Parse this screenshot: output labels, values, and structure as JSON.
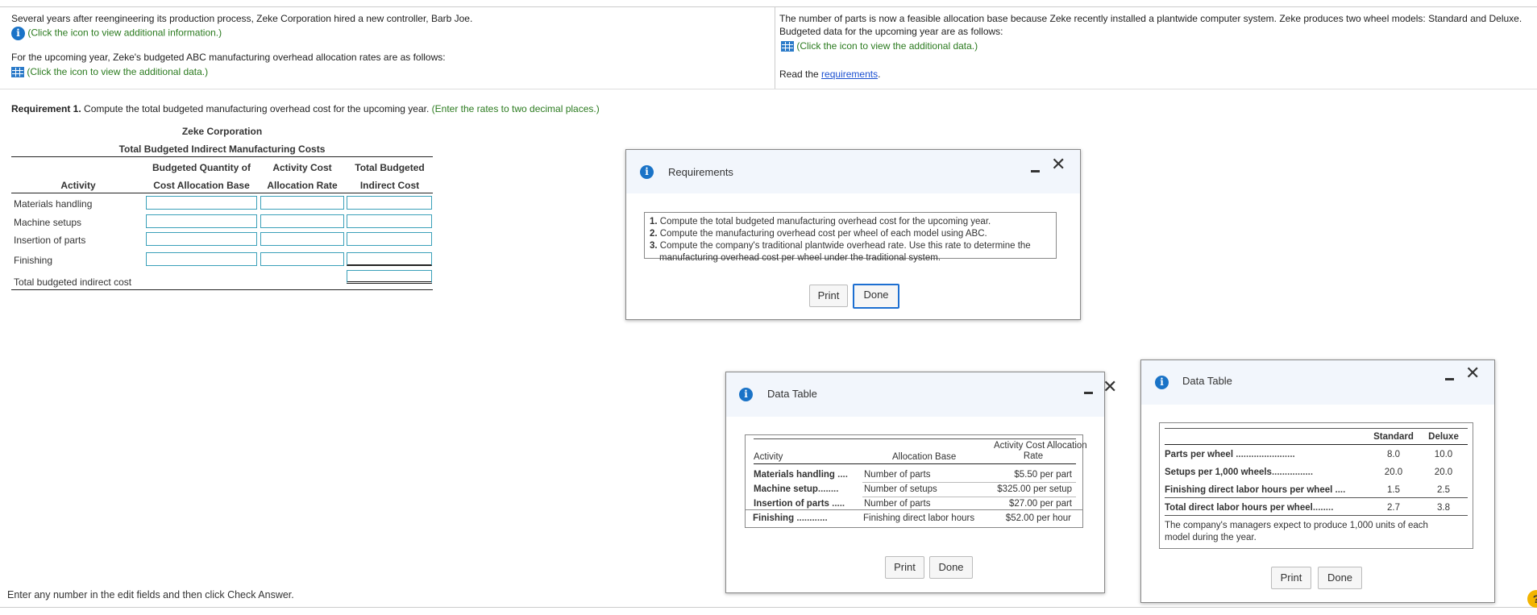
{
  "intro": {
    "left_line1": "Several years after reengineering its production process, Zeke Corporation hired a new controller, Barb Joe.",
    "left_link1": "(Click the icon to view additional information.)",
    "left_line2": "For the upcoming year, Zeke's budgeted ABC manufacturing overhead allocation rates are as follows:",
    "left_link2": "(Click the icon to view the additional data.)",
    "right_line1": "The number of parts is now a feasible allocation base because Zeke recently installed a plantwide computer system. Zeke produces two wheel models: Standard and Deluxe.",
    "right_line2": "Budgeted data for the upcoming year are as follows:",
    "right_link": "(Click the icon to view the additional data.)",
    "read_prefix": "Read the ",
    "read_link": "requirements",
    "read_suffix": "."
  },
  "requirement": {
    "label": "Requirement 1.",
    "text": " Compute the total budgeted manufacturing overhead cost for the upcoming year.",
    "hint": " (Enter the rates to two decimal places.)"
  },
  "table": {
    "company": "Zeke Corporation",
    "subtitle": "Total Budgeted Indirect Manufacturing Costs",
    "headers": {
      "activity": "Activity",
      "qty_line1": "Budgeted Quantity of",
      "qty_line2": "Cost Allocation Base",
      "rate_line1": "Activity Cost",
      "rate_line2": "Allocation Rate",
      "total_line1": "Total Budgeted",
      "total_line2": "Indirect Cost"
    },
    "rows": [
      "Materials handling",
      "Machine setups",
      "Insertion of parts",
      "Finishing"
    ],
    "total_label": "Total budgeted indirect cost"
  },
  "footer_text": "Enter any number in the edit fields and then click Check Answer.",
  "requirements_dialog": {
    "title": "Requirements",
    "items": [
      {
        "num": "1.",
        "text": "Compute the total budgeted manufacturing overhead cost for the upcoming year."
      },
      {
        "num": "2.",
        "text": "Compute the manufacturing overhead cost per wheel of each model using ABC."
      },
      {
        "num": "3.",
        "text": "Compute the company's traditional plantwide overhead rate. Use this rate to determine the"
      }
    ],
    "item3_cont": "manufacturing overhead cost per wheel under the traditional system.",
    "print": "Print",
    "done": "Done"
  },
  "data_table_1": {
    "title": "Data Table",
    "header_activity": "Activity",
    "header_base": "Allocation Base",
    "header_rate_line1": "Activity Cost Allocation",
    "header_rate_line2": "Rate",
    "rows": [
      {
        "activity": "Materials handling",
        "dots": "....",
        "base": "Number of parts",
        "rate": "$5.50 per part"
      },
      {
        "activity": "Machine setup",
        "dots": "........",
        "base": "Number of setups",
        "rate": "$325.00 per setup"
      },
      {
        "activity": "Insertion of parts",
        "dots": ".....",
        "base": "Number of parts",
        "rate": "$27.00 per part"
      },
      {
        "activity": "Finishing",
        "dots": "............",
        "base": "Finishing direct labor hours",
        "rate": "$52.00 per hour"
      }
    ],
    "print": "Print",
    "done": "Done"
  },
  "data_table_2": {
    "title": "Data Table",
    "col_standard": "Standard",
    "col_deluxe": "Deluxe",
    "rows": [
      {
        "label": "Parts per wheel",
        "dots": ".......................",
        "standard": "8.0",
        "deluxe": "10.0"
      },
      {
        "label": "Setups per 1,000 wheels",
        "dots": "................",
        "standard": "20.0",
        "deluxe": "20.0"
      },
      {
        "label": "Finishing direct labor hours per wheel",
        "dots": "....",
        "standard": "1.5",
        "deluxe": "2.5"
      },
      {
        "label": "Total direct labor hours per wheel",
        "dots": "........",
        "standard": "2.7",
        "deluxe": "3.8"
      }
    ],
    "note_line1": "The company's managers expect to produce 1,000 units of each",
    "note_line2": "model during the year.",
    "print": "Print",
    "done": "Done"
  },
  "help_icon": "?"
}
